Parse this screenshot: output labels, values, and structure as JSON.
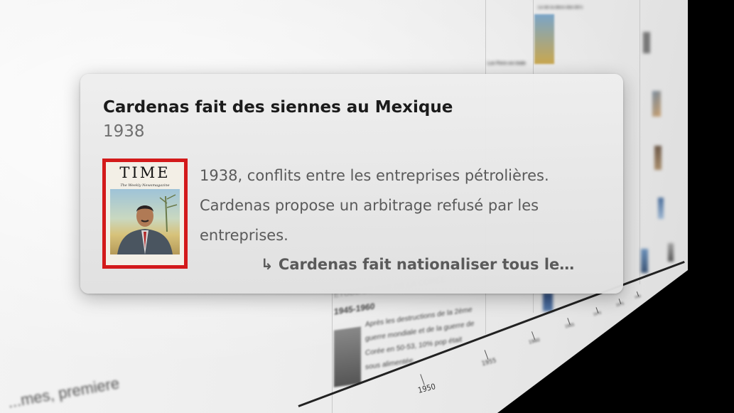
{
  "popover": {
    "title": "Cardenas fait des siennes au Mexique",
    "year": "1938",
    "description": "1938, conflits entre les entreprises pétrolières. Cardenas propose un arbitrage refusé par les entreprises.",
    "more_arrow": "↳",
    "more_text": "Cardenas fait nationaliser tous le…",
    "cover": {
      "title": "TIME",
      "subtitle": "The Weekly Newsmagazine"
    }
  },
  "background": {
    "case_study_label": "ÉTUDE DE CAS DE LA CORÉE",
    "case_study_years": "1945-1960",
    "case_study_text": "Après les destructions de la 2ème guerre mondiale et de la guerre de Corée en 50-53, 10% pop était sous alimentée.",
    "event_top_label": "Loi Fern en Inde",
    "event_top_right": "Le de la déco des 60's",
    "fragment_text": "...mes, premiere"
  },
  "timeline": {
    "ticks": [
      "1950",
      "1955",
      "1960",
      "1965",
      "1970",
      "1975",
      "1980"
    ]
  }
}
